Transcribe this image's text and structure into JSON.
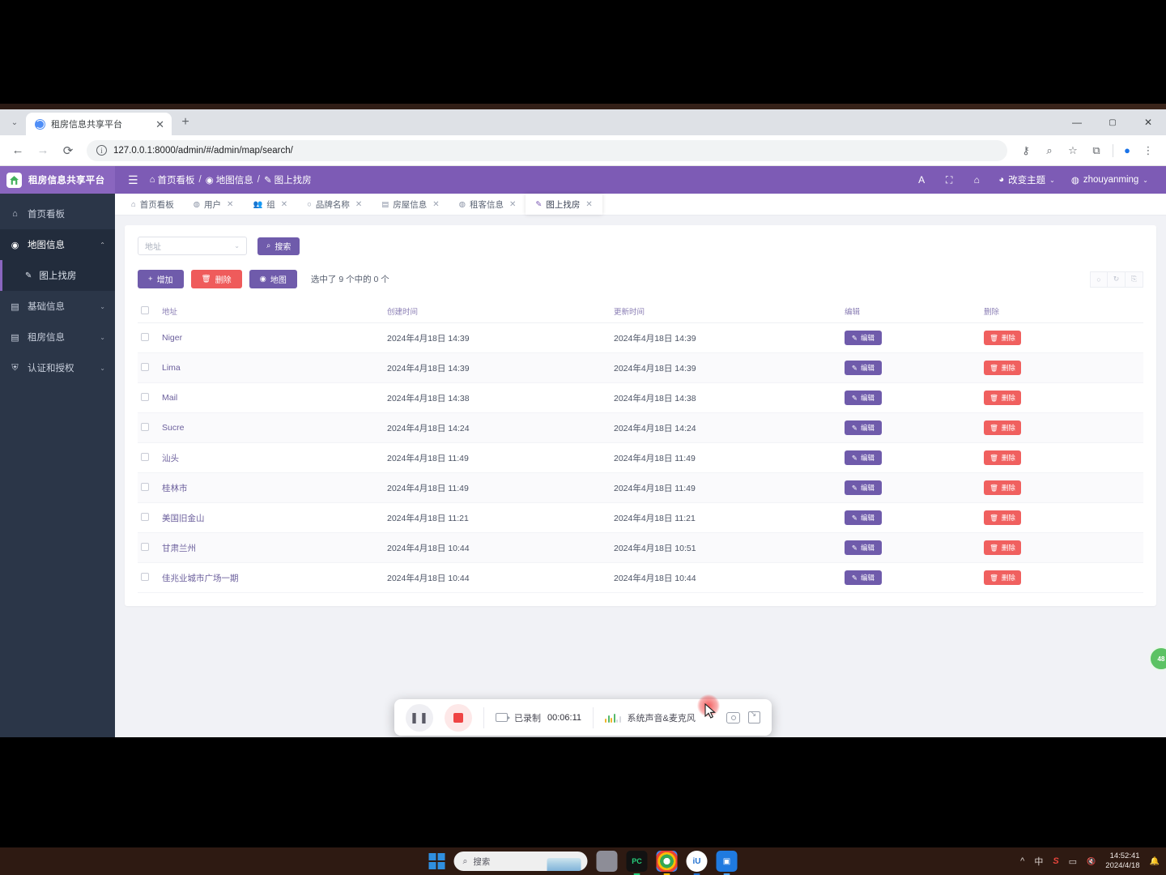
{
  "browser": {
    "tab_title": "租房信息共享平台",
    "tab_close": "✕",
    "new_tab": "+",
    "caret": "⌄",
    "back": "←",
    "forward": "→",
    "reload": "⟳",
    "url": "127.0.0.1:8000/admin/#/admin/map/search/",
    "url_info": "i",
    "key_icon": "⚷",
    "zoom_icon": "⌕",
    "star_icon": "☆",
    "ext_icon": "⧉",
    "profile_icon": "●",
    "menu_icon": "⋮",
    "win_min": "—",
    "win_max": "▢",
    "win_close": "✕"
  },
  "app_header": {
    "brand": "租房信息共享平台",
    "hamburger": "☰",
    "breadcrumb": [
      {
        "icon": "⌂",
        "label": "首页看板"
      },
      {
        "icon": "◉",
        "label": "地图信息"
      },
      {
        "icon": "✎",
        "label": "图上找房"
      }
    ],
    "separator": "/",
    "font_icon": "A",
    "fullscreen_icon": "⛶",
    "home_icon": "⌂",
    "theme": {
      "icon": "◕",
      "label": "改变主题",
      "caret": "⌄"
    },
    "user": {
      "icon": "◍",
      "label": "zhouyanming",
      "caret": "⌄"
    }
  },
  "sidebar": {
    "items": [
      {
        "icon": "⌂",
        "label": "首页看板",
        "caret": "",
        "state": "normal"
      },
      {
        "icon": "◉",
        "label": "地图信息",
        "caret": "⌃",
        "state": "open"
      },
      {
        "icon": "▤",
        "label": "基础信息",
        "caret": "⌄",
        "state": "normal"
      },
      {
        "icon": "▤",
        "label": "租房信息",
        "caret": "⌄",
        "state": "normal"
      },
      {
        "icon": "⛨",
        "label": "认证和授权",
        "caret": "⌄",
        "state": "normal"
      }
    ],
    "sub_item": {
      "icon": "✎",
      "label": "图上找房"
    }
  },
  "main_tabs": [
    {
      "icon": "⌂",
      "label": "首页看板",
      "close": "",
      "active": false
    },
    {
      "icon": "◍",
      "label": "用户",
      "close": "✕",
      "active": false
    },
    {
      "icon": "👥",
      "label": "组",
      "close": "✕",
      "active": false
    },
    {
      "icon": "○",
      "label": "品牌名称",
      "close": "✕",
      "active": false
    },
    {
      "icon": "▤",
      "label": "房屋信息",
      "close": "✕",
      "active": false
    },
    {
      "icon": "◍",
      "label": "租客信息",
      "close": "✕",
      "active": false
    },
    {
      "icon": "✎",
      "label": "图上找房",
      "close": "✕",
      "active": true
    }
  ],
  "toolbar": {
    "filter_placeholder": "地址",
    "filter_caret": "⌄",
    "search_label": "搜索",
    "search_icon": "⌕",
    "add_label": "增加",
    "add_icon": "+",
    "delete_label": "删除",
    "delete_icon": "🗑",
    "map_label": "地图",
    "map_icon": "◉",
    "selection_text": "选中了 9 个中的 0 个",
    "right_icons": [
      "○",
      "↻",
      "⎘"
    ]
  },
  "table": {
    "columns": [
      "地址",
      "创建时间",
      "更新时间",
      "编辑",
      "删除"
    ],
    "edit_label": "编辑",
    "edit_icon": "✎",
    "delete_label": "删除",
    "delete_icon": "🗑",
    "rows": [
      {
        "address": "Niger",
        "created": "2024年4月18日 14:39",
        "updated": "2024年4月18日 14:39"
      },
      {
        "address": "Lima",
        "created": "2024年4月18日 14:39",
        "updated": "2024年4月18日 14:39"
      },
      {
        "address": "Mail",
        "created": "2024年4月18日 14:38",
        "updated": "2024年4月18日 14:38"
      },
      {
        "address": "Sucre",
        "created": "2024年4月18日 14:24",
        "updated": "2024年4月18日 14:24"
      },
      {
        "address": "汕头",
        "created": "2024年4月18日 11:49",
        "updated": "2024年4月18日 11:49"
      },
      {
        "address": "桂林市",
        "created": "2024年4月18日 11:49",
        "updated": "2024年4月18日 11:49"
      },
      {
        "address": "美国旧金山",
        "created": "2024年4月18日 11:21",
        "updated": "2024年4月18日 11:21"
      },
      {
        "address": "甘肃兰州",
        "created": "2024年4月18日 10:44",
        "updated": "2024年4月18日 10:51"
      },
      {
        "address": "佳兆业城市广场一期",
        "created": "2024年4月18日 10:44",
        "updated": "2024年4月18日 10:44"
      }
    ]
  },
  "fab": {
    "label": "48"
  },
  "recorder": {
    "pause_icon": "❚❚",
    "stop_icon": "■",
    "recorded_label": "已录制",
    "elapsed": "00:06:11",
    "audio_label": "系统声音&麦克风",
    "camera_icon": "◎",
    "crop_icon": "⤡"
  },
  "taskbar": {
    "search_placeholder": "搜索",
    "search_icon": "⌕",
    "apps": [
      "task-view",
      "pycharm",
      "chrome",
      "intellij",
      "recorder"
    ],
    "tray": {
      "chevron": "^",
      "ime": "中",
      "sogou": "S",
      "monitor": "▭",
      "volume": "🔇",
      "time": "14:52:41",
      "date": "2024/4/18",
      "bell": "🔔"
    }
  },
  "colors": {
    "brand_purple": "#7d5bb5",
    "button_purple": "#6f5bab",
    "danger_red": "#ef5b5b",
    "sidebar_dark": "#2b3648",
    "fab_green": "#5cc264"
  }
}
